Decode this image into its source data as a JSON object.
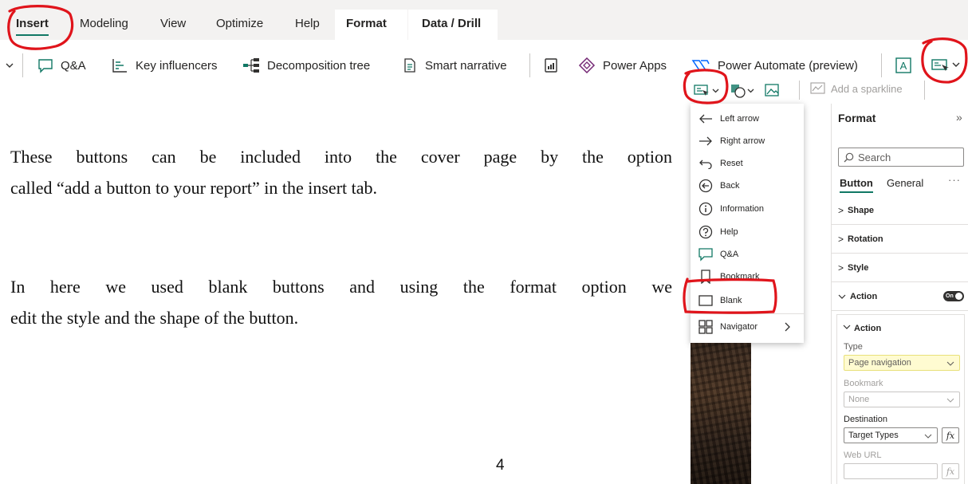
{
  "ribbon": {
    "tabs": [
      {
        "label": "Insert"
      },
      {
        "label": "Modeling"
      },
      {
        "label": "View"
      },
      {
        "label": "Optimize"
      },
      {
        "label": "Help"
      },
      {
        "label": "Format"
      },
      {
        "label": "Data / Drill"
      }
    ],
    "toolbar": {
      "qa": "Q&A",
      "key_influencers": "Key influencers",
      "decomposition_tree": "Decomposition tree",
      "smart_narrative": "Smart narrative",
      "power_apps": "Power Apps",
      "power_automate": "Power Automate (preview)",
      "text_box_icon_label": "A"
    },
    "sparkline": "Add a sparkline"
  },
  "buttons_menu": {
    "items": [
      {
        "label": "Left arrow",
        "icon": "left-arrow-icon"
      },
      {
        "label": "Right arrow",
        "icon": "right-arrow-icon"
      },
      {
        "label": "Reset",
        "icon": "reset-icon"
      },
      {
        "label": "Back",
        "icon": "back-icon"
      },
      {
        "label": "Information",
        "icon": "info-icon"
      },
      {
        "label": "Help",
        "icon": "help-icon"
      },
      {
        "label": "Q&A",
        "icon": "qa-icon"
      },
      {
        "label": "Bookmark",
        "icon": "bookmark-icon"
      },
      {
        "label": "Blank",
        "icon": "blank-icon"
      },
      {
        "label": "Navigator",
        "icon": "navigator-icon"
      }
    ]
  },
  "format_pane": {
    "title": "Format",
    "search_placeholder": "Search",
    "tabs": [
      "Button",
      "General"
    ],
    "sections": [
      "Shape",
      "Rotation",
      "Style",
      "Action"
    ],
    "action_toggle": "On",
    "action_card": {
      "title": "Action",
      "type_label": "Type",
      "type_value": "Page navigation",
      "bookmark_label": "Bookmark",
      "bookmark_value": "None",
      "destination_label": "Destination",
      "destination_value": "Target Types",
      "web_url_label": "Web URL",
      "fx": "fx"
    }
  },
  "document": {
    "para1_line1": "These buttons can be included into the cover page by the option",
    "para1_line2": "called “add a button to your report” in the insert tab.",
    "para2_line1": "In here we used blank buttons and using the format option we",
    "para2_line2": "edit the style and the shape of the button.",
    "page_number": "4"
  },
  "colors": {
    "accent": "#117865",
    "annotation": "#e0141b",
    "highlight": "#fffbd1",
    "ribbon_bg": "#f3f2f1"
  }
}
